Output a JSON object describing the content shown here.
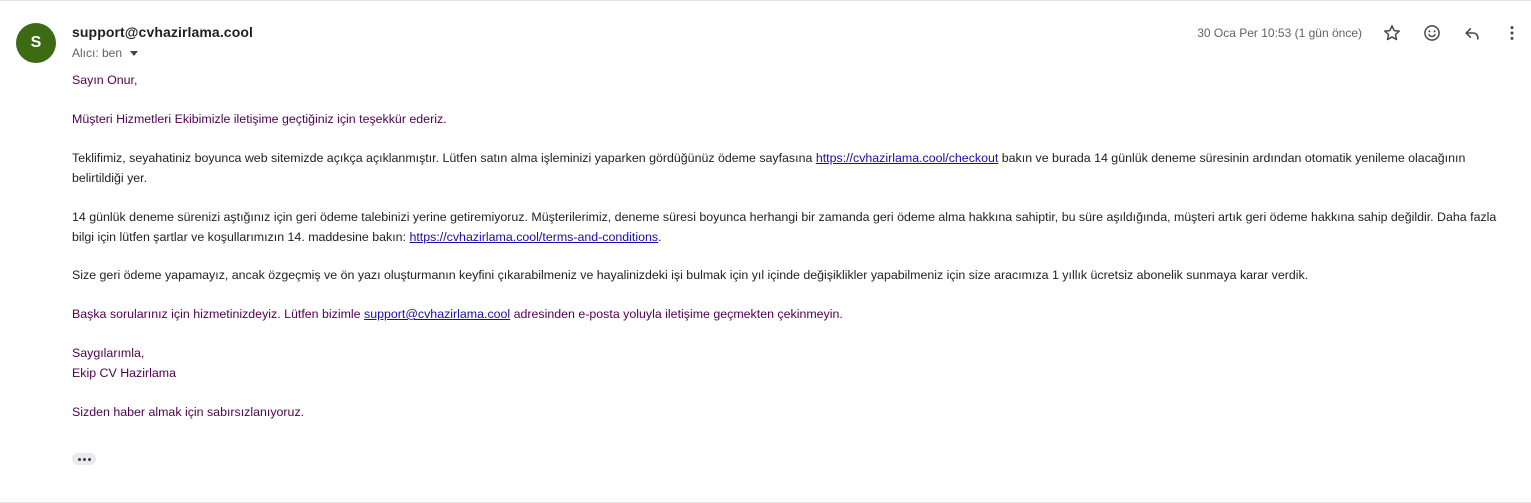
{
  "email": {
    "avatar_letter": "S",
    "sender": "support@cvhazirlama.cool",
    "recipient_label": "Alıcı: ben",
    "date": "30 Oca Per 10:53 (1 gün önce)",
    "icons": [
      "star-icon",
      "emoji-icon",
      "reply-icon",
      "more-vert-icon"
    ]
  },
  "body": {
    "greeting": "Sayın Onur,",
    "thanks": "Müşteri Hizmetleri Ekibimizle iletişime geçtiğiniz için teşekkür ederiz.",
    "p3_before": "Teklifimiz, seyahatiniz boyunca web sitemizde açıkça açıklanmıştır. Lütfen satın alma işleminizi yaparken gördüğünüz ödeme sayfasına ",
    "p3_link": "https://cvhazirlama.cool/checkout",
    "p3_after": " bakın ve burada 14 günlük deneme süresinin ardından otomatik yenileme olacağının belirtildiği yer.",
    "p4_before": "14 günlük deneme sürenizi aştığınız için geri ödeme talebinizi yerine getiremiyoruz. Müşterilerimiz, deneme süresi boyunca herhangi bir zamanda geri ödeme alma hakkına sahiptir, bu süre aşıldığında, müşteri artık geri ödeme hakkına sahip değildir. Daha fazla bilgi için lütfen şartlar ve koşullarımızın 14. maddesine bakın: ",
    "p4_link": "https://cvhazirlama.cool/terms-and-conditions",
    "p4_after": ".",
    "p5": "Size geri ödeme yapamayız, ancak özgeçmiş ve ön yazı oluşturmanın keyfini çıkarabilmeniz ve hayalinizdeki işi bulmak için yıl içinde değişiklikler yapabilmeniz için size aracımıza 1 yıllık ücretsiz abonelik sunmaya karar verdik.",
    "p6_before": "Başka sorularınız için hizmetinizdeyiz. Lütfen bizimle ",
    "p6_link": "support@cvhazirlama.cool",
    "p6_after": " adresinden e-posta yoluyla iletişime geçmekten çekinmeyin.",
    "closing": "Saygılarımla,",
    "signature": "Ekip CV Hazirlama",
    "postscript": "Sizden haber almak için sabırsızlanıyoruz."
  },
  "colors": {
    "avatar_bg": "#3d6a13",
    "quoted_text": "#500050",
    "body_text": "#222222",
    "link": "#1a0dab"
  }
}
